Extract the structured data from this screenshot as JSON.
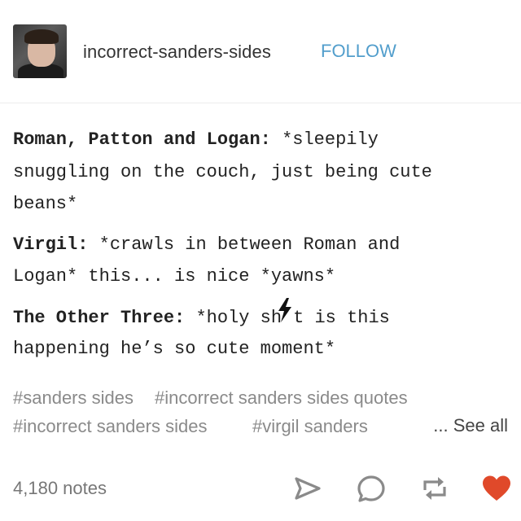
{
  "header": {
    "blog_name": "incorrect-sanders-sides",
    "follow_label": "FOLLOW",
    "accent": "#529ecc"
  },
  "post": {
    "dialogue": [
      {
        "speaker": "Roman, Patton and Logan:",
        "lines": [
          "*sleepily",
          "snuggling on the couch, just being cute",
          "beans*"
        ]
      },
      {
        "speaker": "Virgil:",
        "lines": [
          "*crawls in between Roman and",
          "Logan* this... is nice *yawns*"
        ]
      },
      {
        "speaker": "The Other Three:",
        "line1_a": "*holy sh",
        "line1_b": "t is this",
        "lines": [
          "happening he’s so cute moment*"
        ]
      }
    ]
  },
  "tags": {
    "items": [
      "#sanders sides",
      "#incorrect sanders sides quotes",
      "#incorrect sanders sides",
      "#virgil sanders"
    ],
    "see_all_label": "... See all"
  },
  "footer": {
    "notes": "4,180 notes",
    "icons": [
      "share-icon",
      "reply-icon",
      "reblog-icon",
      "like-icon"
    ],
    "like_color": "#e0492a",
    "icon_color": "#8a8a8a"
  }
}
